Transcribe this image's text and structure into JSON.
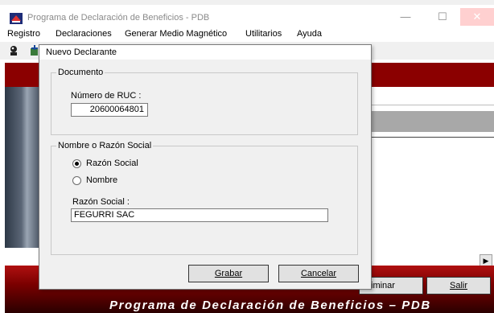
{
  "window": {
    "title": "Programa de Declaración de Beneficios - PDB",
    "minimize_glyph": "—",
    "maximize_glyph": "☐",
    "close_glyph": "✕"
  },
  "menu": {
    "items": [
      "Registro",
      "Declaraciones",
      "Generar Medio Magnético",
      "Utilitarios",
      "Ayuda"
    ]
  },
  "background": {
    "footer_text": "Programa de Declaración de Beneficios – PDB",
    "eliminar_label": "iminar",
    "salir_label": "Salir",
    "scroll_right_glyph": "▶"
  },
  "dialog": {
    "title": "Nuevo Declarante",
    "documento_group": "Documento",
    "ruc_label": "Número de RUC :",
    "ruc_value": "20600064801",
    "nombre_group": "Nombre o Razón Social",
    "radio_razon_social": "Razón Social",
    "radio_nombre": "Nombre",
    "razon_social_label": "Razón Social :",
    "razon_social_value": "FEGURRI SAC",
    "grabar_label": "Grabar",
    "cancelar_label": "Cancelar",
    "selected_option": "Razón Social"
  },
  "colors": {
    "brand_red": "#8b0000",
    "dialog_bg": "#f0f0f0"
  }
}
